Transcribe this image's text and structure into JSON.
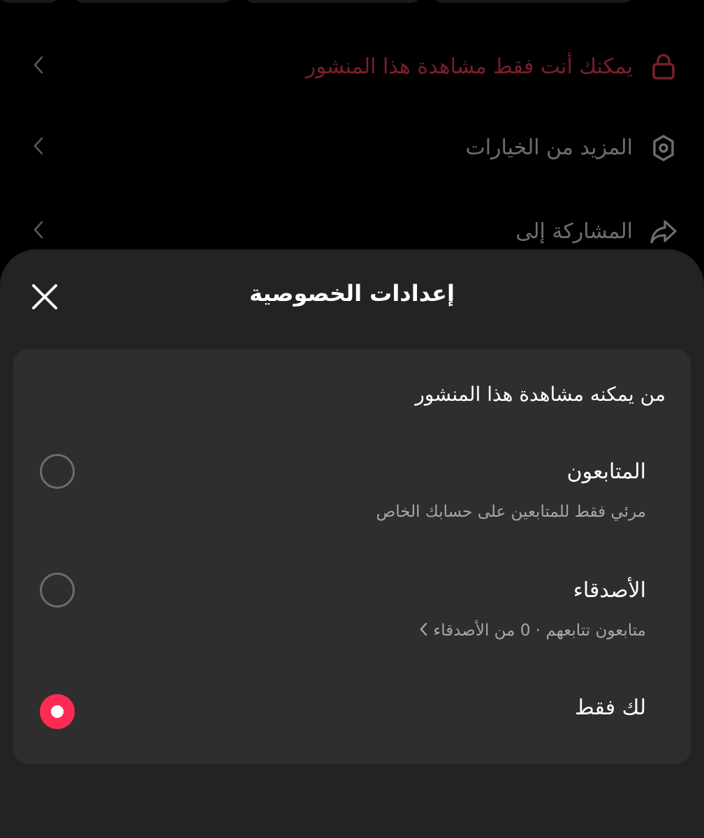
{
  "background": {
    "rows": [
      {
        "label": "يمكنك أنت فقط مشاهدة هذا المنشور",
        "icon": "lock-icon",
        "color": "#7a1f2c"
      },
      {
        "label": "المزيد من الخيارات",
        "icon": "gear-icon",
        "color": "#6e6e6e"
      },
      {
        "label": "المشاركة إلى",
        "icon": "share-icon",
        "color": "#6e6e6e"
      }
    ]
  },
  "sheet": {
    "title": "إعدادات الخصوصية",
    "close_icon": "close-icon",
    "card": {
      "heading": "من يمكنه مشاهدة هذا المنشور",
      "options": [
        {
          "title": "المتابعون",
          "subtitle": "مرئي فقط للمتابعين على حسابك الخاص",
          "selected": false
        },
        {
          "title": "الأصدقاء",
          "subtitle": "متابعون تتابعهم · 0 من الأصدقاء",
          "selected": false
        },
        {
          "title": "لك فقط",
          "selected": true
        }
      ]
    }
  },
  "colors": {
    "accent": "#fe2c55",
    "sheet_bg": "#232323",
    "card_bg": "#2e2e2e"
  }
}
